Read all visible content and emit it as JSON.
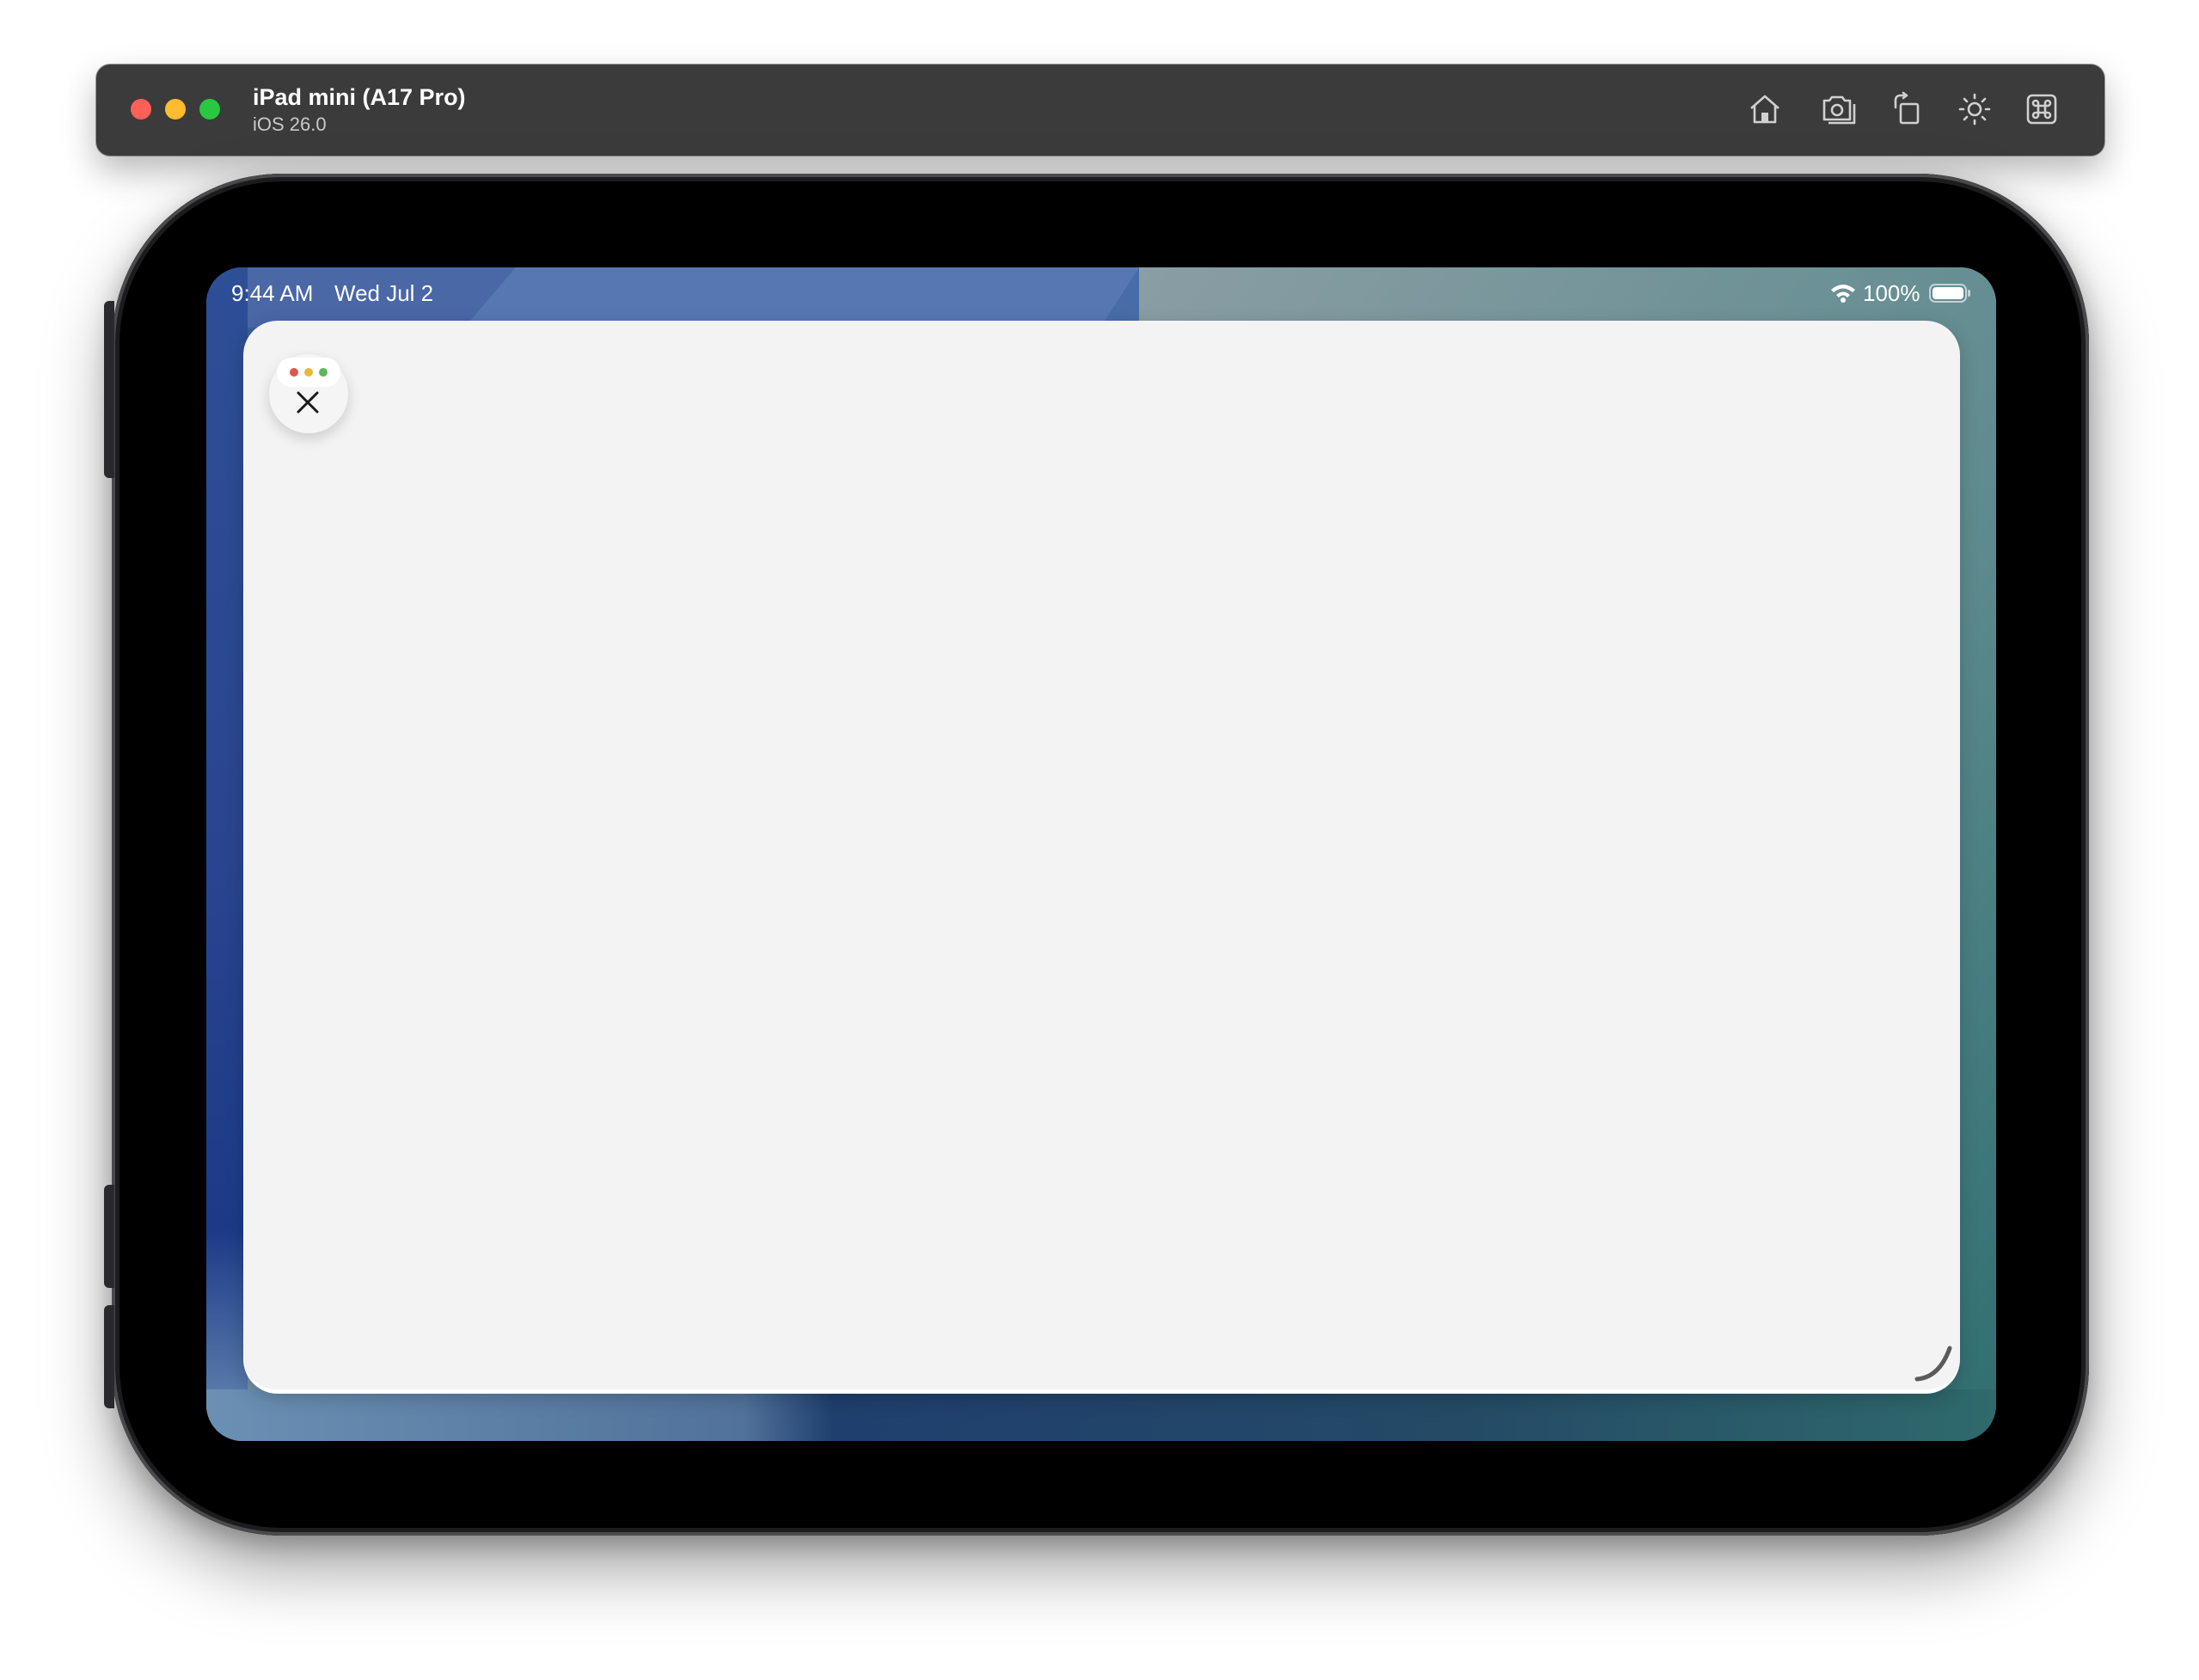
{
  "simulator": {
    "device_name": "iPad mini (A17 Pro)",
    "os_version": "iOS 26.0",
    "toolbar": [
      "home-icon",
      "screenshot-icon",
      "rotate-icon",
      "appearance-icon",
      "keyboard-command-icon"
    ]
  },
  "status_bar": {
    "time": "9:44 AM",
    "date": "Wed Jul 2",
    "battery": "100%"
  },
  "app_window": {
    "controls": [
      "close-icon"
    ]
  },
  "colors": {
    "window_bg": "#f3f3f3",
    "close_red": "#e0564a",
    "minimize_yellow": "#e9b73d",
    "zoom_green": "#5bb85b",
    "titlebar": "#3b3b3c"
  }
}
